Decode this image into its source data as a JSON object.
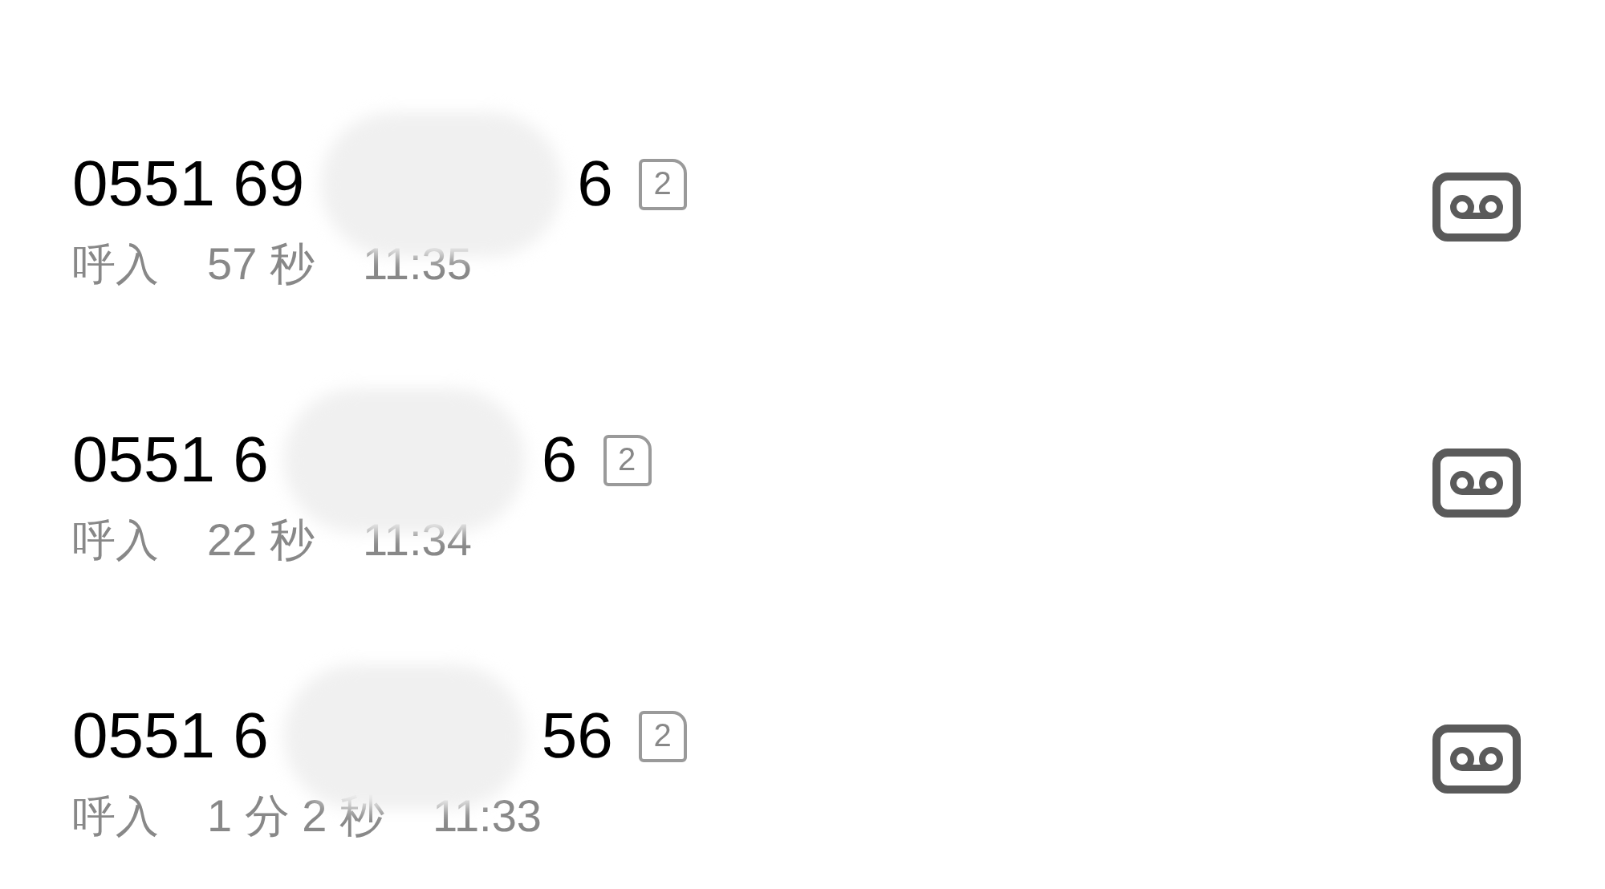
{
  "calls": [
    {
      "number_start": "0551 69",
      "number_end": "6",
      "sim": "2",
      "direction": "呼入",
      "duration": "57 秒",
      "time": "11:35"
    },
    {
      "number_start": "0551 6",
      "number_end": "6",
      "sim": "2",
      "direction": "呼入",
      "duration": "22 秒",
      "time": "11:34"
    },
    {
      "number_start": "0551 6",
      "number_end": "56",
      "sim": "2",
      "direction": "呼入",
      "duration": "1 分 2 秒",
      "time": "11:33"
    }
  ]
}
